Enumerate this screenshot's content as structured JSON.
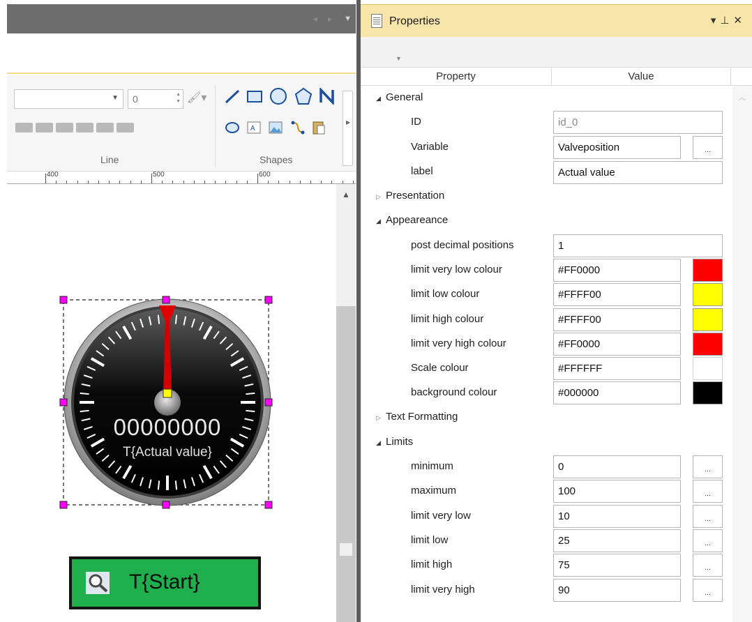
{
  "designer": {
    "ribbon": {
      "line_width_value": "0",
      "line_group_label": "Line",
      "shapes_group_label": "Shapes"
    },
    "ruler": {
      "labels": [
        "400",
        "500",
        "600"
      ]
    },
    "gauge": {
      "value_text": "00000000",
      "label_text": "T{Actual value}"
    },
    "start_button": {
      "label": "T{Start}"
    }
  },
  "properties": {
    "title": "Properties",
    "columns": {
      "property": "Property",
      "value": "Value"
    },
    "categories": {
      "general": "General",
      "presentation": "Presentation",
      "appearance": "Appeareance",
      "text_formatting": "Text Formatting",
      "limits": "Limits"
    },
    "general": {
      "id_label": "ID",
      "id_value": "id_0",
      "variable_label": "Variable",
      "variable_value": "Valveposition",
      "label_label": "label",
      "label_value": "Actual value"
    },
    "appearance": {
      "post_decimal_label": "post decimal positions",
      "post_decimal_value": "1",
      "limit_very_low_colour_label": "limit very low colour",
      "limit_very_low_colour_value": "#FF0000",
      "limit_low_colour_label": "limit low colour",
      "limit_low_colour_value": "#FFFF00",
      "limit_high_colour_label": "limit high colour",
      "limit_high_colour_value": "#FFFF00",
      "limit_very_high_colour_label": "limit very high colour",
      "limit_very_high_colour_value": "#FF0000",
      "scale_colour_label": "Scale colour",
      "scale_colour_value": "#FFFFFF",
      "background_colour_label": "background colour",
      "background_colour_value": "#000000"
    },
    "limits": {
      "minimum_label": "minimum",
      "minimum_value": "0",
      "maximum_label": "maximum",
      "maximum_value": "100",
      "limit_very_low_label": "limit very low",
      "limit_very_low_value": "10",
      "limit_low_label": "limit low",
      "limit_low_value": "25",
      "limit_high_label": "limit high",
      "limit_high_value": "75",
      "limit_very_high_label": "limit very high",
      "limit_very_high_value": "90"
    },
    "ellipsis": "..."
  },
  "colors": {
    "accent": "#F8E5A9",
    "start_button": "#1FB04D",
    "selection_handle": "#FF00FF",
    "needle": "#E00000"
  }
}
